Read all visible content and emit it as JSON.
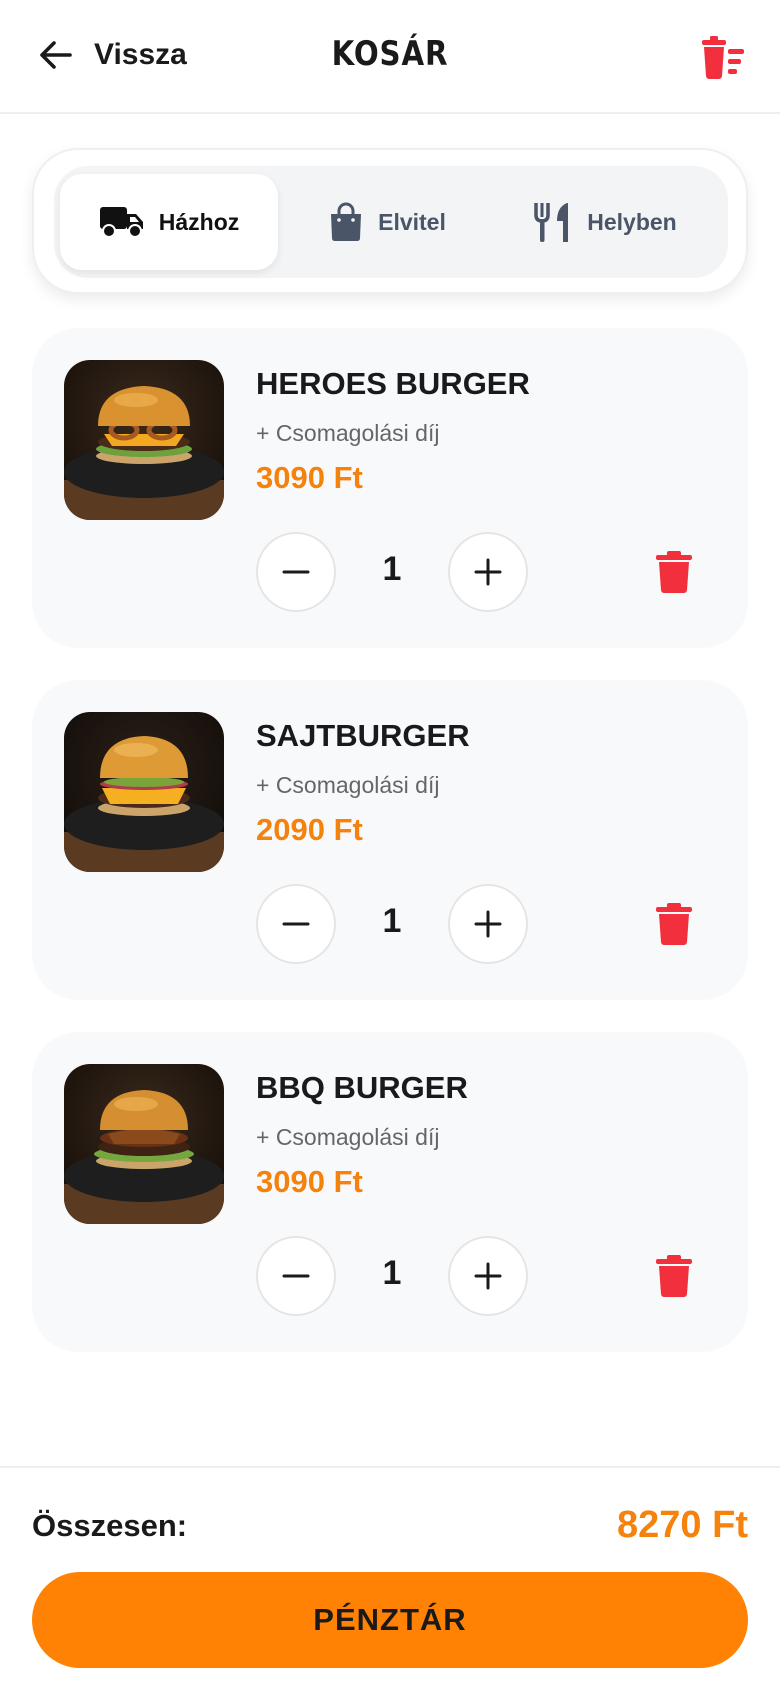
{
  "header": {
    "back_label": "Vissza",
    "title": "KOSÁR",
    "back_icon": "arrow-left-icon",
    "clear_icon": "clear-cart-icon"
  },
  "order_modes": [
    {
      "label": "Házhoz",
      "icon": "truck-icon",
      "active": true
    },
    {
      "label": "Elvitel",
      "icon": "shopping-bag-icon",
      "active": false
    },
    {
      "label": "Helyben",
      "icon": "utensils-icon",
      "active": false
    }
  ],
  "items": [
    {
      "name": "HEROES BURGER",
      "extra": "+ Csomagolási díj",
      "price": "3090 Ft",
      "quantity": "1"
    },
    {
      "name": "SAJTBURGER",
      "extra": "+ Csomagolási díj",
      "price": "2090 Ft",
      "quantity": "1"
    },
    {
      "name": "BBQ BURGER",
      "extra": "+ Csomagolási díj",
      "price": "3090 Ft",
      "quantity": "1"
    }
  ],
  "footer": {
    "total_label": "Összesen:",
    "total_value": "8270 Ft",
    "checkout_label": "PÉNZTÁR"
  },
  "colors": {
    "accent": "#ff8204",
    "price": "#f5820d",
    "danger": "#f2303d",
    "text": "#1a1a1a",
    "muted": "#4a5568"
  }
}
